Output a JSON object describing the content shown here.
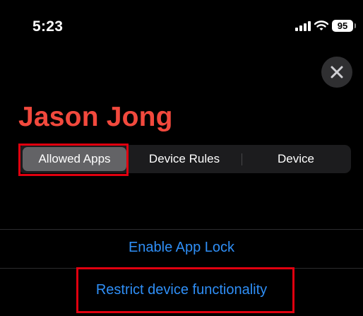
{
  "status_bar": {
    "time": "5:23",
    "battery_level": "95",
    "icons": [
      "cellular-signal-icon",
      "wifi-icon",
      "battery-icon"
    ]
  },
  "header": {
    "close_icon": "close-icon",
    "title": "Jason Jong"
  },
  "tabs": [
    {
      "label": "Allowed Apps",
      "selected": true
    },
    {
      "label": "Device Rules",
      "selected": false
    },
    {
      "label": "Device",
      "selected": false
    }
  ],
  "actions": {
    "enable_app_lock": "Enable App Lock",
    "restrict_device": "Restrict device functionality"
  },
  "colors": {
    "background": "#000000",
    "title": "#f2493d",
    "link": "#2f8ff7",
    "segment_bg": "#1c1c1e",
    "segment_selected": "#636366",
    "highlight": "#e0000f"
  }
}
